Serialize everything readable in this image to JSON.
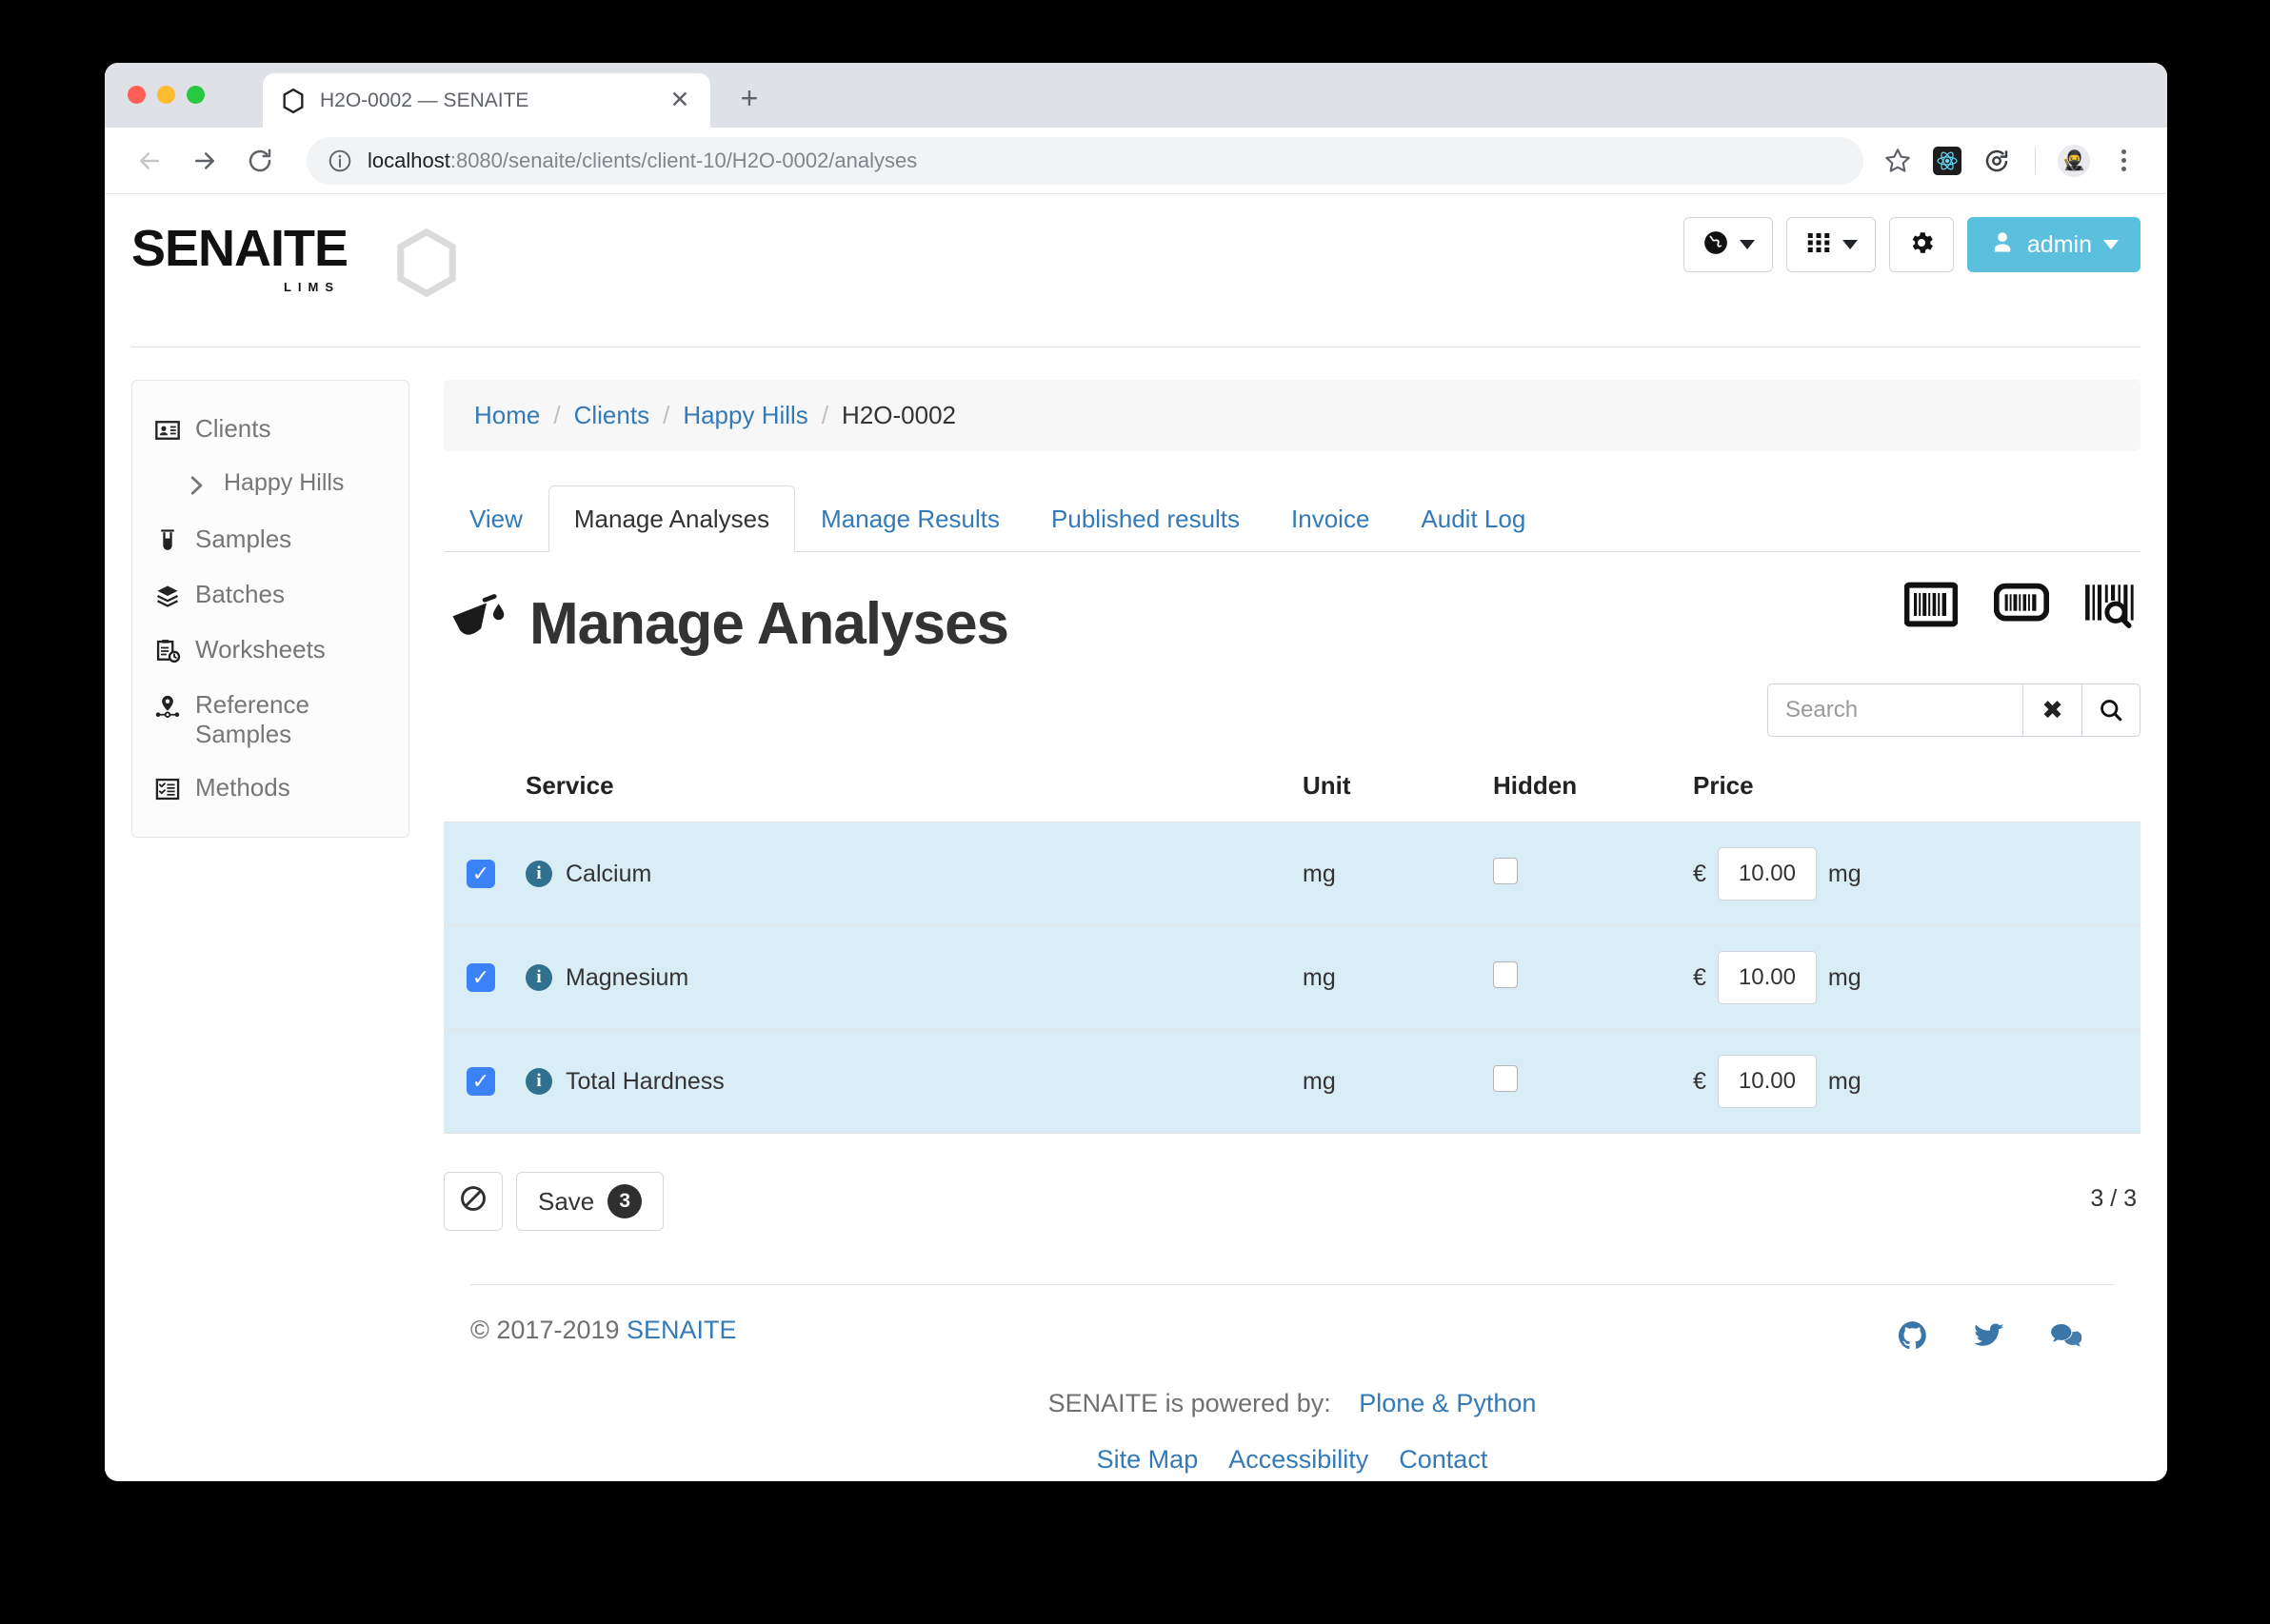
{
  "browser": {
    "tab_title": "H2O-0002 — SENAITE",
    "favicon": "hexagon-icon",
    "new_tab_label": "+",
    "close_label": "✕",
    "url_host": "localhost",
    "url_path": ":8080/senaite/clients/client-10/H2O-0002/analyses",
    "toolbar_icons": [
      "bookmark-star-icon",
      "react-devtools-icon",
      "sync-extension-icon",
      "profile-avatar-icon",
      "chrome-menu-icon"
    ]
  },
  "header": {
    "logo_word": "SENAITE",
    "logo_sub": "LIMS",
    "actions": [
      {
        "name": "language-selector",
        "icon": "globe-icon",
        "label": ""
      },
      {
        "name": "apps-grid",
        "icon": "grid-icon",
        "label": ""
      },
      {
        "name": "settings",
        "icon": "gear-icon",
        "label": ""
      }
    ],
    "user_label": "admin",
    "accent_color": "#5bc0de"
  },
  "sidebar": {
    "items": [
      {
        "label": "Clients",
        "icon": "contact-card-icon",
        "sub": false
      },
      {
        "label": "Happy Hills",
        "icon": "chevron-right-icon",
        "sub": true
      },
      {
        "label": "Samples",
        "icon": "test-tube-icon",
        "sub": false
      },
      {
        "label": "Batches",
        "icon": "layers-icon",
        "sub": false
      },
      {
        "label": "Worksheets",
        "icon": "clipboard-clock-icon",
        "sub": false
      },
      {
        "label": "Reference Samples",
        "icon": "map-pin-icon",
        "sub": false
      },
      {
        "label": "Methods",
        "icon": "checklist-icon",
        "sub": false
      }
    ]
  },
  "breadcrumb": {
    "items": [
      "Home",
      "Clients",
      "Happy Hills",
      "H2O-0002"
    ],
    "separator": "/"
  },
  "tabs": [
    {
      "label": "View",
      "active": false
    },
    {
      "label": "Manage Analyses",
      "active": true
    },
    {
      "label": "Manage Results",
      "active": false
    },
    {
      "label": "Published results",
      "active": false
    },
    {
      "label": "Invoice",
      "active": false
    },
    {
      "label": "Audit Log",
      "active": false
    }
  ],
  "main": {
    "title": "Manage Analyses",
    "title_icon": "flask-pour-icon",
    "barcode_buttons": [
      "barcode-square-icon",
      "barcode-rounded-icon",
      "barcode-search-icon"
    ]
  },
  "search": {
    "value": "",
    "placeholder": "Search",
    "clear_label": "✖",
    "search_label": "search-icon"
  },
  "table": {
    "columns": [
      "Service",
      "Unit",
      "Hidden",
      "Price"
    ],
    "currency_symbol": "€",
    "rows": [
      {
        "selected": true,
        "service": "Calcium",
        "unit": "mg",
        "hidden": false,
        "price": "10.00",
        "price_unit": "mg"
      },
      {
        "selected": true,
        "service": "Magnesium",
        "unit": "mg",
        "hidden": false,
        "price": "10.00",
        "price_unit": "mg"
      },
      {
        "selected": true,
        "service": "Total Hardness",
        "unit": "mg",
        "hidden": false,
        "price": "10.00",
        "price_unit": "mg"
      }
    ]
  },
  "actions": {
    "clear_icon": "no-entry-icon",
    "save_label": "Save",
    "save_count": "3",
    "count_display": "3 / 3"
  },
  "footer": {
    "copyright_prefix": "© 2017-2019",
    "copyright_link": "SENAITE",
    "socials": [
      "github-icon",
      "twitter-icon",
      "comments-icon"
    ],
    "powered_text": "SENAITE is powered by:",
    "powered_link": "Plone & Python",
    "links": [
      "Site Map",
      "Accessibility",
      "Contact"
    ]
  }
}
